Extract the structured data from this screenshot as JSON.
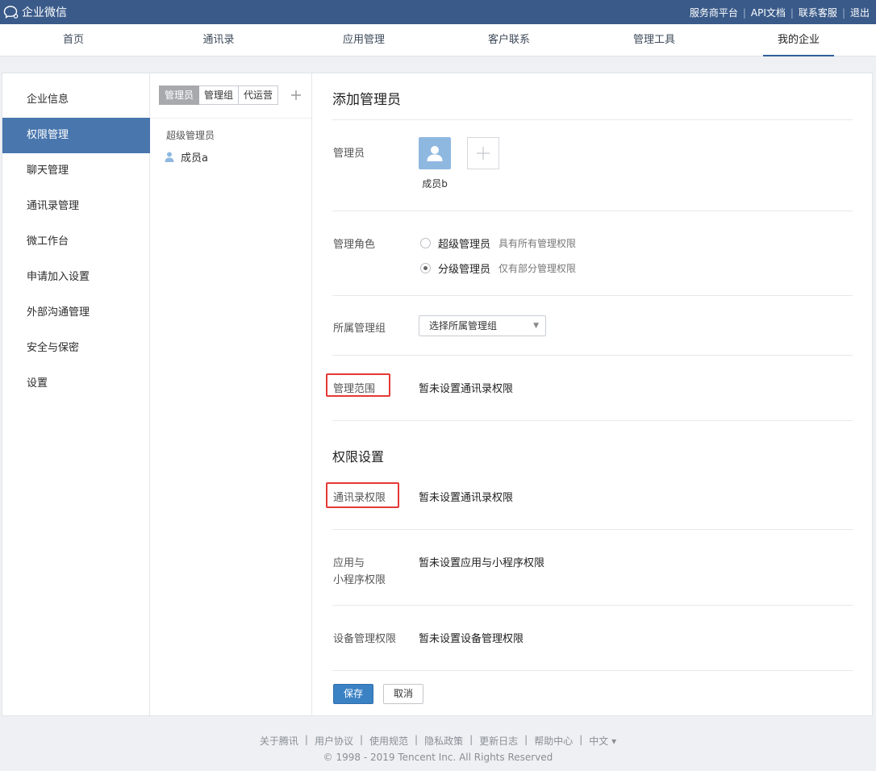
{
  "header": {
    "logo_text": "企业微信",
    "links": [
      "服务商平台",
      "API文档",
      "联系客服",
      "退出"
    ]
  },
  "nav": {
    "items": [
      "首页",
      "通讯录",
      "应用管理",
      "客户联系",
      "管理工具",
      "我的企业"
    ],
    "active": "我的企业"
  },
  "sidebar": {
    "items": [
      "企业信息",
      "权限管理",
      "聊天管理",
      "通讯录管理",
      "微工作台",
      "申请加入设置",
      "外部沟通管理",
      "安全与保密",
      "设置"
    ],
    "active": "权限管理"
  },
  "middle": {
    "tabs": [
      "管理员",
      "管理组",
      "代运营"
    ],
    "active_tab": "管理员",
    "add_icon": "plus-icon",
    "group_title": "超级管理员",
    "member": "成员a"
  },
  "form": {
    "title": "添加管理员",
    "admin_label": "管理员",
    "admin_name": "成员b",
    "role_label": "管理角色",
    "roles": [
      {
        "label": "超级管理员",
        "desc": "具有所有管理权限",
        "checked": false
      },
      {
        "label": "分级管理员",
        "desc": "仅有部分管理权限",
        "checked": true
      }
    ],
    "group_label": "所属管理组",
    "group_select_placeholder": "选择所属管理组",
    "scope_label": "管理范围",
    "scope_value": "暂未设置通讯录权限",
    "perm_title": "权限设置",
    "contacts_perm_label": "通讯录权限",
    "contacts_perm_value": "暂未设置通讯录权限",
    "app_perm_label_1": "应用与",
    "app_perm_label_2": "小程序权限",
    "app_perm_value": "暂未设置应用与小程序权限",
    "device_perm_label": "设备管理权限",
    "device_perm_value": "暂未设置设备管理权限",
    "save": "保存",
    "cancel": "取消"
  },
  "footer": {
    "links": [
      "关于腾讯",
      "用户协议",
      "使用规范",
      "隐私政策",
      "更新日志",
      "帮助中心",
      "中文 ▾"
    ],
    "copyright": "© 1998 - 2019 Tencent Inc. All Rights Reserved"
  },
  "colors": {
    "topbar": "#3a5b8a",
    "sidebar_active": "#4876ad",
    "primary_button": "#3b82c4",
    "highlight_box": "#e53935"
  }
}
